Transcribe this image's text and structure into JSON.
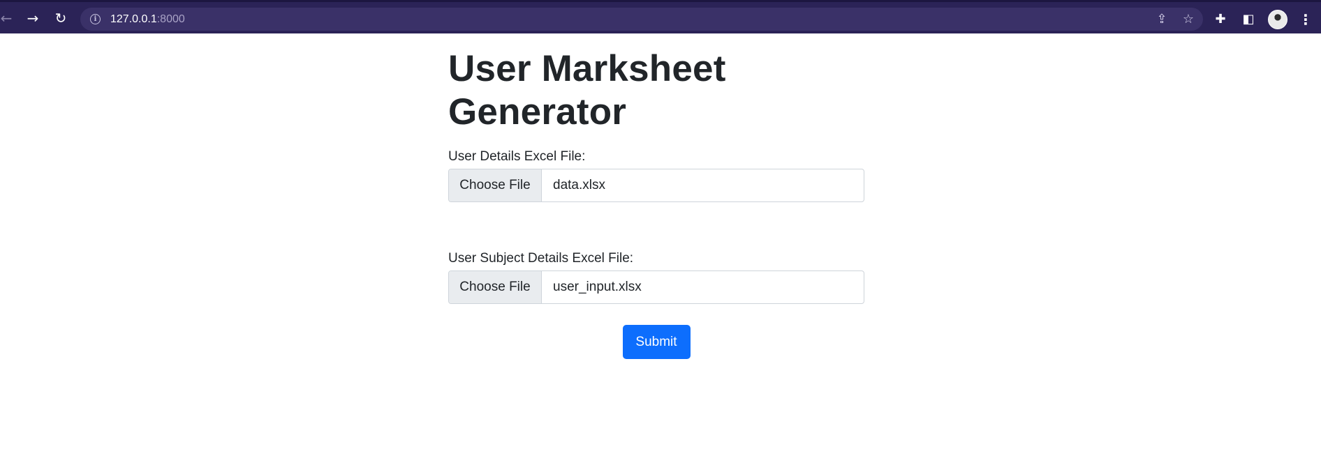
{
  "browser": {
    "url_host": "127.0.0.1",
    "url_port": ":8000",
    "back_icon": "←",
    "forward_icon": "→",
    "reload_icon": "↻",
    "info_icon": "i",
    "share_icon": "⇪",
    "star_icon": "☆",
    "extensions_icon": "✚",
    "sidepanel_icon": "◧",
    "menu_icon": "⋮"
  },
  "page": {
    "title": "User Marksheet Generator",
    "user_details": {
      "label": "User Details Excel File:",
      "button": "Choose File",
      "filename": "data.xlsx"
    },
    "subject_details": {
      "label": "User Subject Details Excel File:",
      "button": "Choose File",
      "filename": "user_input.xlsx"
    },
    "submit_label": "Submit"
  },
  "colors": {
    "chrome_bg": "#2b2357",
    "omnibox_bg": "#3a3168",
    "primary": "#0d6efd"
  }
}
